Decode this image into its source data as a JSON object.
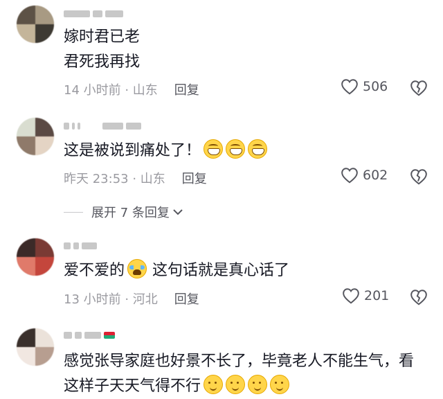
{
  "comments": [
    {
      "text_lines": [
        "嫁时君已老",
        "君死我再找"
      ],
      "time_location": "14 小时前 · 山东",
      "reply_label": "回复",
      "like_count": "506"
    },
    {
      "text_lines": [
        "这是被说到痛处了！"
      ],
      "emojis": [
        "grin-face",
        "grin-face",
        "grin-face"
      ],
      "time_location": "昨天 23:53 · 山东",
      "reply_label": "回复",
      "like_count": "602",
      "expand_label": "展开 7 条回复"
    },
    {
      "text_before": "爱不爱的",
      "emoji": "crying-face",
      "text_after": "这句话就是真心话了",
      "time_location": "13 小时前 · 河北",
      "reply_label": "回复",
      "like_count": "201"
    },
    {
      "text_lines": [
        "感觉张导家庭也好景不长了，毕竟老人不能生气，看",
        "这样子天天气得不行"
      ],
      "emojis": [
        "smirk-face",
        "smirk-face",
        "smirk-face",
        "smirk-face"
      ]
    }
  ],
  "colors": {
    "text": "#161823",
    "meta": "#9a9aa0",
    "reply": "#55565e"
  }
}
